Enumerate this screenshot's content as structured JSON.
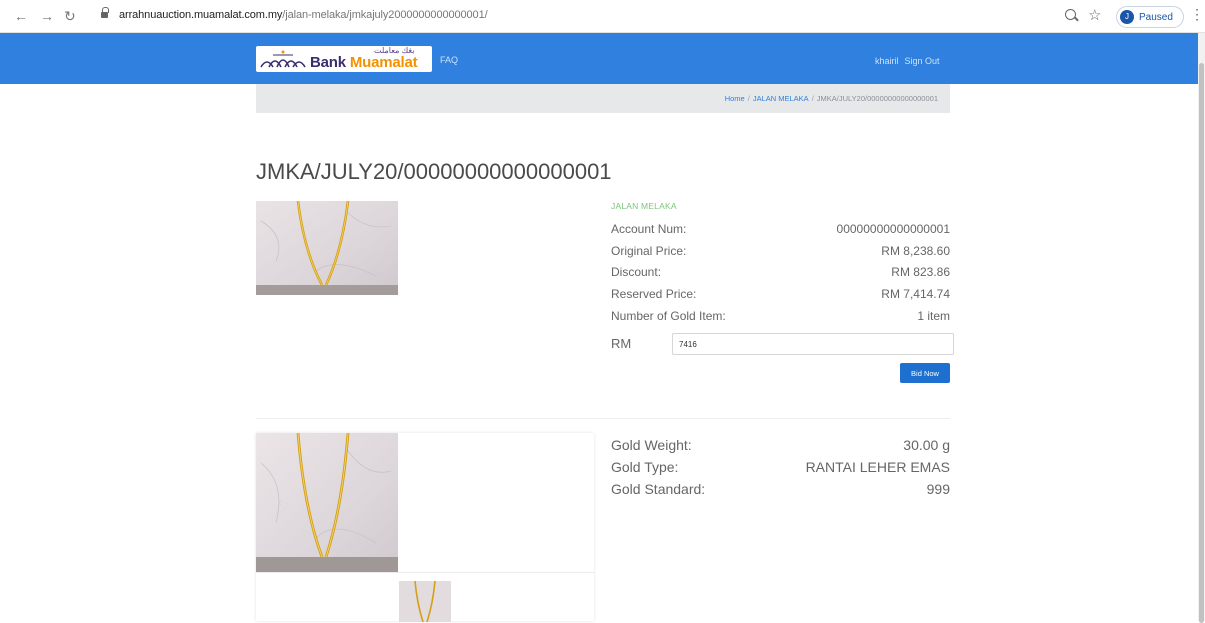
{
  "browser": {
    "url_host": "arrahnuauction.muamalat.com.my",
    "url_path": "/jalan-melaka/jmkajuly2000000000000001/",
    "profile_status": "Paused",
    "profile_initial": "J"
  },
  "header": {
    "logo_arabic": "بڠك معاملت",
    "logo_text_main": "Bank ",
    "logo_text_accent": "Muamalat",
    "faq": "FAQ",
    "user_name": "khairil",
    "sign_out": "Sign Out"
  },
  "breadcrumb": {
    "home": "Home",
    "branch": "JALAN MELAKA",
    "current": "JMKA/JULY20/00000000000000001",
    "separator": "/"
  },
  "page_title": "JMKA/JULY20/00000000000000001",
  "details": {
    "branch": "JALAN MELAKA",
    "rows": [
      {
        "label": "Account Num:",
        "value": "00000000000000001"
      },
      {
        "label": "Original Price:",
        "value": "RM 8,238.60"
      },
      {
        "label": "Discount:",
        "value": "RM 823.86"
      },
      {
        "label": "Reserved Price:",
        "value": "RM 7,414.74"
      },
      {
        "label": "Number of Gold Item:",
        "value": "1 item"
      }
    ],
    "bid_currency": "RM",
    "bid_value": "7416",
    "bid_button": "Bid Now"
  },
  "specs": [
    {
      "label": "Gold Weight:",
      "value": "30.00 g"
    },
    {
      "label": "Gold Type:",
      "value": "RANTAI LEHER EMAS"
    },
    {
      "label": "Gold Standard:",
      "value": "999"
    }
  ],
  "gallery": {
    "prev_arrow": "‹"
  },
  "colors": {
    "header_blue": "#2f80df",
    "button_blue": "#1d6fd0",
    "branch_green": "#7bc67b",
    "gold": "#d4a017"
  }
}
